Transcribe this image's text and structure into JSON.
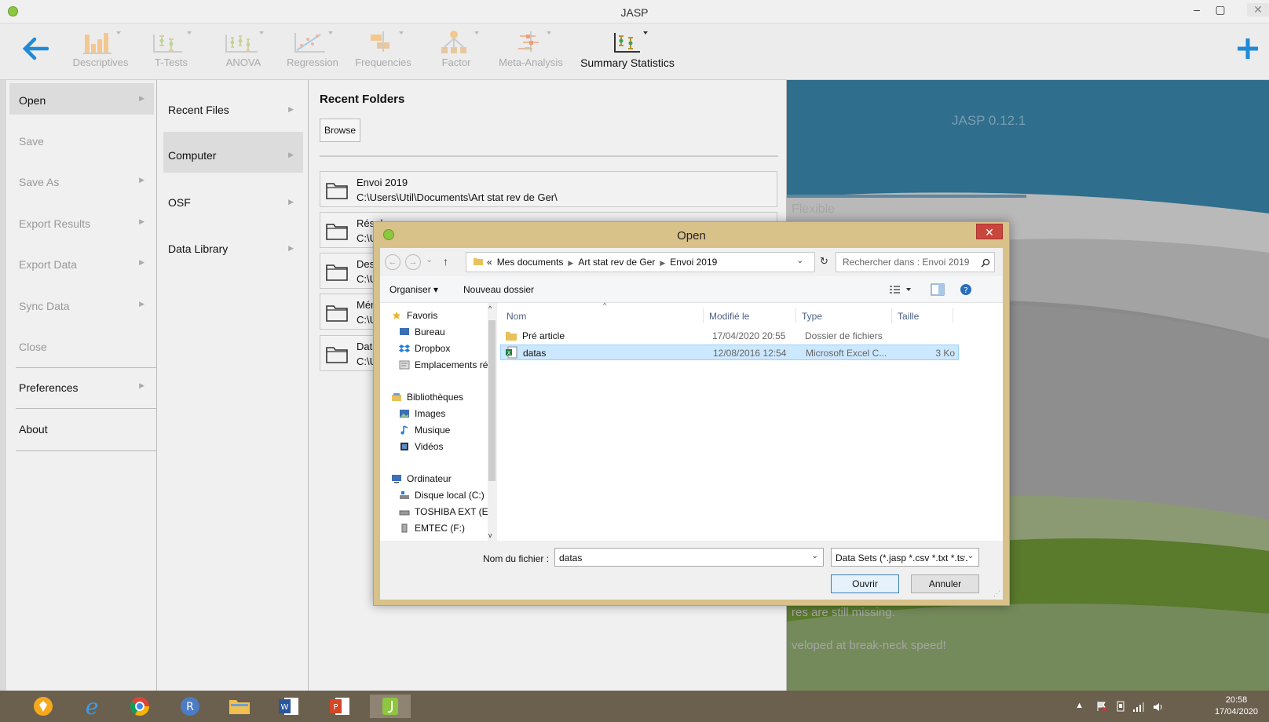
{
  "window": {
    "title": "JASP",
    "minimize": "–",
    "restore": "▢",
    "close": "✕"
  },
  "ribbon": {
    "back": "🡐",
    "add": "+",
    "modules": [
      {
        "label": "Descriptives"
      },
      {
        "label": "T-Tests"
      },
      {
        "label": "ANOVA"
      },
      {
        "label": "Regression"
      },
      {
        "label": "Frequencies"
      },
      {
        "label": "Factor"
      },
      {
        "label": "Meta-Analysis"
      },
      {
        "label": "Summary Statistics"
      }
    ]
  },
  "file_menu": {
    "items": [
      {
        "label": "Open"
      },
      {
        "label": "Save"
      },
      {
        "label": "Save As"
      },
      {
        "label": "Export Results"
      },
      {
        "label": "Export Data"
      },
      {
        "label": "Sync Data"
      },
      {
        "label": "Close"
      },
      {
        "label": "Preferences"
      },
      {
        "label": "About"
      }
    ]
  },
  "open_menu": {
    "items": [
      {
        "label": "Recent Files"
      },
      {
        "label": "Computer"
      },
      {
        "label": "OSF"
      },
      {
        "label": "Data Library"
      }
    ]
  },
  "recent_folders": {
    "title": "Recent Folders",
    "browse": "Browse",
    "folders": [
      {
        "name": "Envoi 2019",
        "path": "C:\\Users\\Util\\Documents\\Art stat rev de Ger\\"
      },
      {
        "name": "Résul",
        "path": "C:\\U"
      },
      {
        "name": "Desl",
        "path": "C:\\U"
      },
      {
        "name": "Mén",
        "path": "C:\\U"
      },
      {
        "name": "Data",
        "path": "C:\\U"
      }
    ]
  },
  "welcome": {
    "version": "JASP 0.12.1",
    "line1": "Flexible",
    "line2": "res are still missing.",
    "line3": "veloped at break-neck speed!"
  },
  "dialog": {
    "title": "Open",
    "close": "✕",
    "nav": {
      "back": "←",
      "forward": "→",
      "recent": "⌄",
      "up": "↑",
      "refresh": "↻"
    },
    "breadcrumb": [
      "«",
      "Mes documents",
      "Art stat rev de Ger",
      "Envoi 2019"
    ],
    "search_placeholder": "Rechercher dans : Envoi 2019",
    "organize": "Organiser ▾",
    "new_folder": "Nouveau dossier",
    "nav_pane": [
      {
        "label": "Favoris",
        "icon": "star-icon"
      },
      {
        "label": "Bureau",
        "icon": "desktop-icon"
      },
      {
        "label": "Dropbox",
        "icon": "dropbox-icon"
      },
      {
        "label": "Emplacements ré",
        "icon": "recent-places-icon"
      },
      {
        "label": "Bibliothèques",
        "icon": "libraries-icon"
      },
      {
        "label": "Images",
        "icon": "images-icon"
      },
      {
        "label": "Musique",
        "icon": "music-icon"
      },
      {
        "label": "Vidéos",
        "icon": "videos-icon"
      },
      {
        "label": "Ordinateur",
        "icon": "computer-icon"
      },
      {
        "label": "Disque local (C:)",
        "icon": "drive-icon"
      },
      {
        "label": "TOSHIBA EXT (E:",
        "icon": "usb-drive-icon"
      },
      {
        "label": "EMTEC (F:)",
        "icon": "usb-stick-icon"
      }
    ],
    "columns": {
      "name": "Nom",
      "modified": "Modifié le",
      "type": "Type",
      "size": "Taille"
    },
    "files": [
      {
        "name": "Pré article",
        "modified": "17/04/2020 20:55",
        "type": "Dossier de fichiers",
        "size": ""
      },
      {
        "name": "datas",
        "modified": "12/08/2016 12:54",
        "type": "Microsoft Excel C...",
        "size": "3 Ko"
      }
    ],
    "filename_label": "Nom du fichier :",
    "filename_value": "datas",
    "filetype": "Data Sets (*.jasp *.csv *.txt *.tsv",
    "open_button": "Ouvrir",
    "cancel_button": "Annuler"
  },
  "taskbar": {
    "clock_time": "20:58",
    "clock_date": "17/04/2020",
    "tray_up": "▲"
  }
}
